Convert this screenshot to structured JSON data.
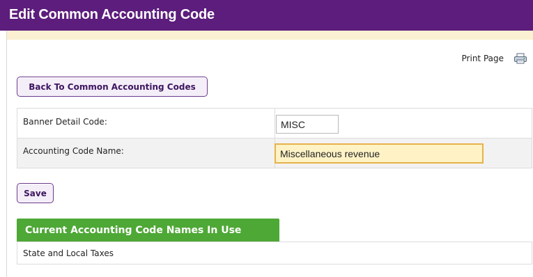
{
  "header": {
    "title": "Edit Common Accounting Code"
  },
  "toolbar": {
    "print_label": "Print Page",
    "print_icon": "printer-icon"
  },
  "nav": {
    "back_label": "Back To Common Accounting Codes"
  },
  "form": {
    "banner_detail_code_label": "Banner Detail Code:",
    "banner_detail_code_value": "MISC",
    "accounting_code_name_label": "Accounting Code Name:",
    "accounting_code_name_value": "Miscellaneous revenue"
  },
  "actions": {
    "save_label": "Save"
  },
  "in_use": {
    "title": "Current Accounting Code Names In Use",
    "items": [
      "State and Local Taxes"
    ]
  },
  "colors": {
    "header_bg": "#5c1d7c",
    "accent_green": "#4ea836",
    "focus_field_bg": "#fff3c6",
    "focus_field_border": "#e6b24a",
    "button_border": "#6b3a8a"
  }
}
